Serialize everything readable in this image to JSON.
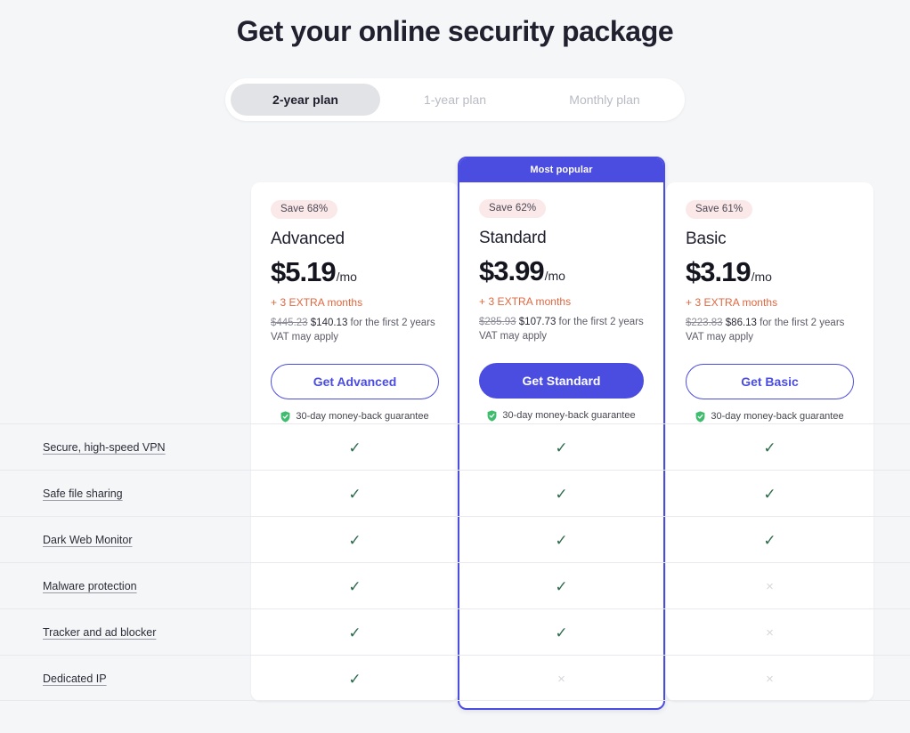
{
  "page": {
    "title": "Get your online security package",
    "background": "#f5f6f8",
    "accent": "#4b4ce0",
    "check_color": "#2f6b4f",
    "cross_color": "#d6d7db",
    "extra_color": "#e0673f",
    "badge_bg": "#fbe9ea"
  },
  "plan_switcher": {
    "tabs": [
      {
        "label": "2-year plan",
        "active": true
      },
      {
        "label": "1-year plan",
        "active": false
      },
      {
        "label": "Monthly plan",
        "active": false
      }
    ]
  },
  "plans": [
    {
      "id": "advanced",
      "badge": "Save 68%",
      "name": "Advanced",
      "price": "$5.19",
      "period": "/mo",
      "extra": "+ 3 EXTRA months",
      "old_price": "$445.23",
      "new_price": "$140.13",
      "terms_suffix": " for the first 2 years",
      "vat": "VAT may apply",
      "cta": "Get Advanced",
      "guarantee": "30-day money-back guarantee",
      "featured": false,
      "banner": ""
    },
    {
      "id": "standard",
      "badge": "Save 62%",
      "name": "Standard",
      "price": "$3.99",
      "period": "/mo",
      "extra": "+ 3 EXTRA months",
      "old_price": "$285.93",
      "new_price": "$107.73",
      "terms_suffix": " for the first 2 years",
      "vat": "VAT may apply",
      "cta": "Get Standard",
      "guarantee": "30-day money-back guarantee",
      "featured": true,
      "banner": "Most popular"
    },
    {
      "id": "basic",
      "badge": "Save 61%",
      "name": "Basic",
      "price": "$3.19",
      "period": "/mo",
      "extra": "+ 3 EXTRA months",
      "old_price": "$223.83",
      "new_price": "$86.13",
      "terms_suffix": " for the first 2 years",
      "vat": "VAT may apply",
      "cta": "Get Basic",
      "guarantee": "30-day money-back guarantee",
      "featured": false,
      "banner": ""
    }
  ],
  "features": [
    {
      "label": "Secure, high-speed VPN",
      "advanced": "check",
      "standard": "check",
      "basic": "check"
    },
    {
      "label": "Safe file sharing",
      "advanced": "check",
      "standard": "check",
      "basic": "check"
    },
    {
      "label": "Dark Web Monitor",
      "advanced": "check",
      "standard": "check",
      "basic": "check"
    },
    {
      "label": "Malware protection",
      "advanced": "check",
      "standard": "check",
      "basic": "cross"
    },
    {
      "label": "Tracker and ad blocker",
      "advanced": "check",
      "standard": "check",
      "basic": "cross"
    },
    {
      "label": "Dedicated IP",
      "advanced": "check",
      "standard": "cross",
      "basic": "cross"
    }
  ],
  "icons": {
    "shield": "shield-check-icon",
    "check": "check-icon",
    "cross": "cross-icon"
  }
}
